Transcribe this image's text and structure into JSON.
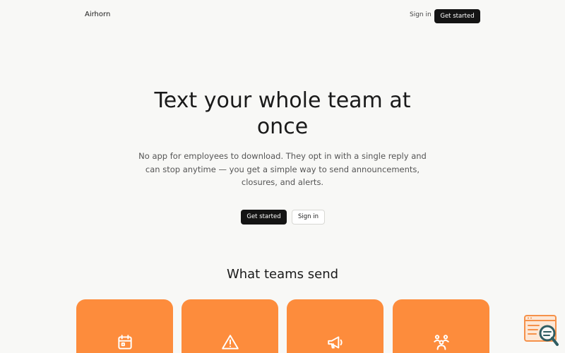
{
  "header": {
    "logo": "Airhorn",
    "signin_label": "Sign in",
    "cta_label": "Get started"
  },
  "hero": {
    "title": "Text your whole team at once",
    "subtitle": "No app for employees to download. They opt in with a single reply and can stop anytime — you get a simple way to send announcements, closures, and alerts.",
    "primary_label": "Get started",
    "secondary_label": "Sign in"
  },
  "section": {
    "title": "What teams send",
    "cards": [
      {
        "icon": "calendar-icon"
      },
      {
        "icon": "alert-triangle-icon"
      },
      {
        "icon": "megaphone-icon"
      },
      {
        "icon": "users-icon"
      }
    ]
  },
  "colors": {
    "background": "#f8f8f6",
    "primary_button": "#141414",
    "card": "#fd8c3c",
    "widget": "#f5914a"
  },
  "widget": {
    "icon": "search-log-icon"
  }
}
